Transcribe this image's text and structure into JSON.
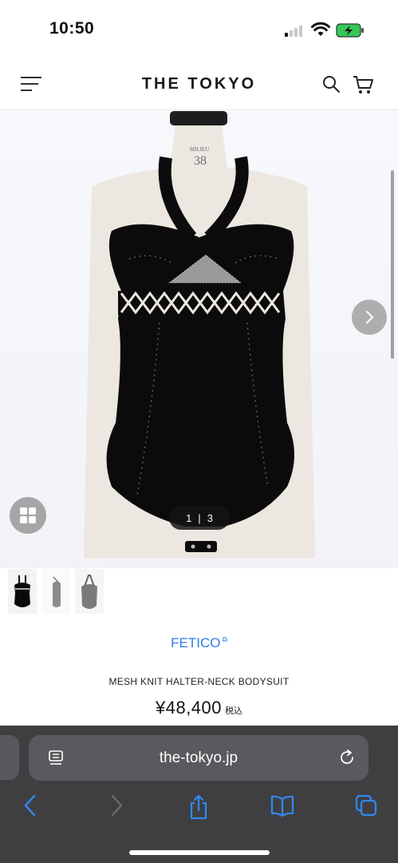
{
  "status_bar": {
    "time": "10:50"
  },
  "header": {
    "logo": "THE TOKYO",
    "icons": [
      "menu-icon",
      "search-icon",
      "cart-icon"
    ]
  },
  "gallery": {
    "counter_current": "1",
    "counter_separator": "|",
    "counter_total": "3",
    "mannequin_label_top": "MILIEU",
    "mannequin_label_size": "38",
    "icons": [
      "chevron-right-icon",
      "grid-icon"
    ]
  },
  "product": {
    "brand": "FETICO",
    "name": "MESH KNIT HALTER-NECK BODYSUIT",
    "price": "¥48,400",
    "tax_label": "税込"
  },
  "browser": {
    "url": "the-tokyo.jp",
    "icons": [
      "reader-icon",
      "reload-icon",
      "back-icon",
      "forward-icon",
      "share-icon",
      "bookmarks-icon",
      "tabs-icon"
    ]
  },
  "colors": {
    "brand_link": "#2f7de1",
    "browser_bg": "#3f3f42",
    "toolbar_accent": "#2f8af5"
  }
}
